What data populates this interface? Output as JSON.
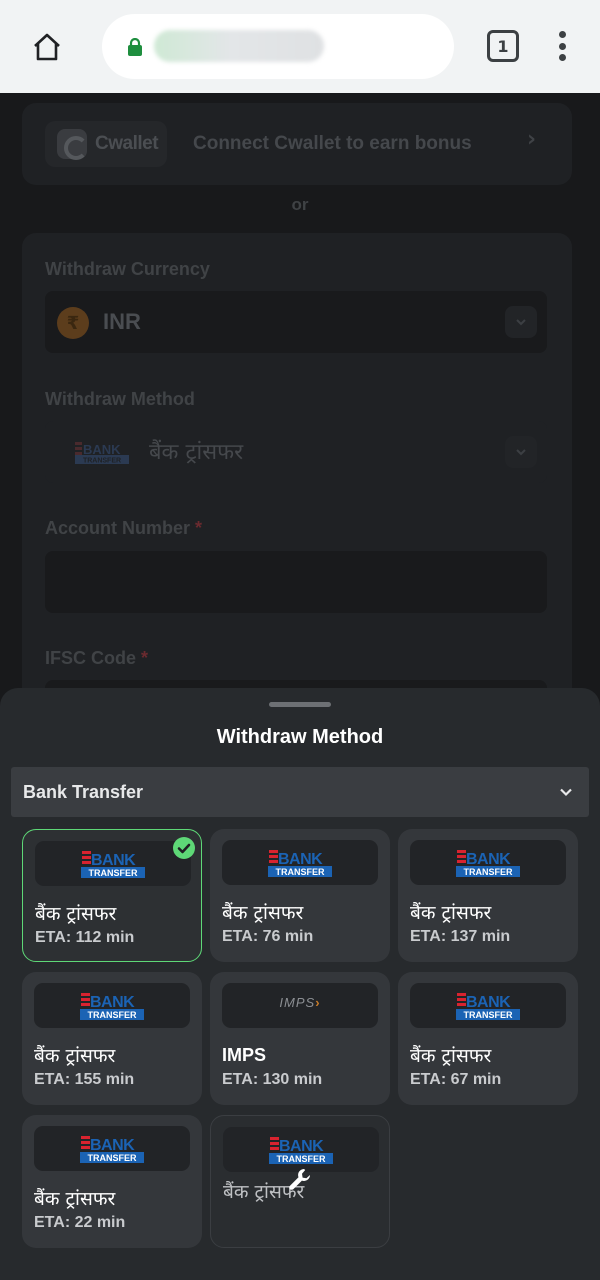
{
  "browser": {
    "url_text": "",
    "tab_count": "1"
  },
  "background_page": {
    "cwallet_logo_text": "Cwallet",
    "connect_text": "Connect Cwallet to earn bonus",
    "or_text": "or",
    "withdraw_currency_label": "Withdraw Currency",
    "currency_value": "INR",
    "withdraw_method_label": "Withdraw Method",
    "method_value": "बैंक ट्रांसफर",
    "account_number_label": "Account Number",
    "ifsc_label": "IFSC Code",
    "required_mark": "*"
  },
  "sheet": {
    "title": "Withdraw Method",
    "dropdown_label": "Bank Transfer",
    "methods": [
      {
        "logo": "bank-transfer-logo",
        "name": "बैंक ट्रांसफर",
        "eta": "ETA: 112 min",
        "selected": true
      },
      {
        "logo": "bank-transfer-logo",
        "name": "बैंक ट्रांसफर",
        "eta": "ETA: 76 min"
      },
      {
        "logo": "bank-transfer-logo",
        "name": "बैंक ट्रांसफर",
        "eta": "ETA: 137 min"
      },
      {
        "logo": "bank-transfer-logo",
        "name": "बैंक ट्रांसफर",
        "eta": "ETA: 155 min"
      },
      {
        "logo": "imps-logo",
        "logo_text": "IMPS",
        "name": "IMPS",
        "eta": "ETA: 130 min"
      },
      {
        "logo": "bank-transfer-logo",
        "name": "बैंक ट्रांसफर",
        "eta": "ETA: 67 min"
      },
      {
        "logo": "bank-transfer-logo",
        "name": "बैंक ट्रांसफर",
        "eta": "ETA: 22 min"
      },
      {
        "logo": "bank-transfer-logo",
        "name": "बैंक ट्रांसफर",
        "eta": "",
        "maintenance": true
      }
    ]
  },
  "bank_logo": {
    "line1": "BANK",
    "line2": "TRANSFER"
  },
  "colors": {
    "selected_accent": "#5ed877",
    "bank_logo_red": "#d9232f",
    "bank_logo_blue": "#1b63b4"
  }
}
